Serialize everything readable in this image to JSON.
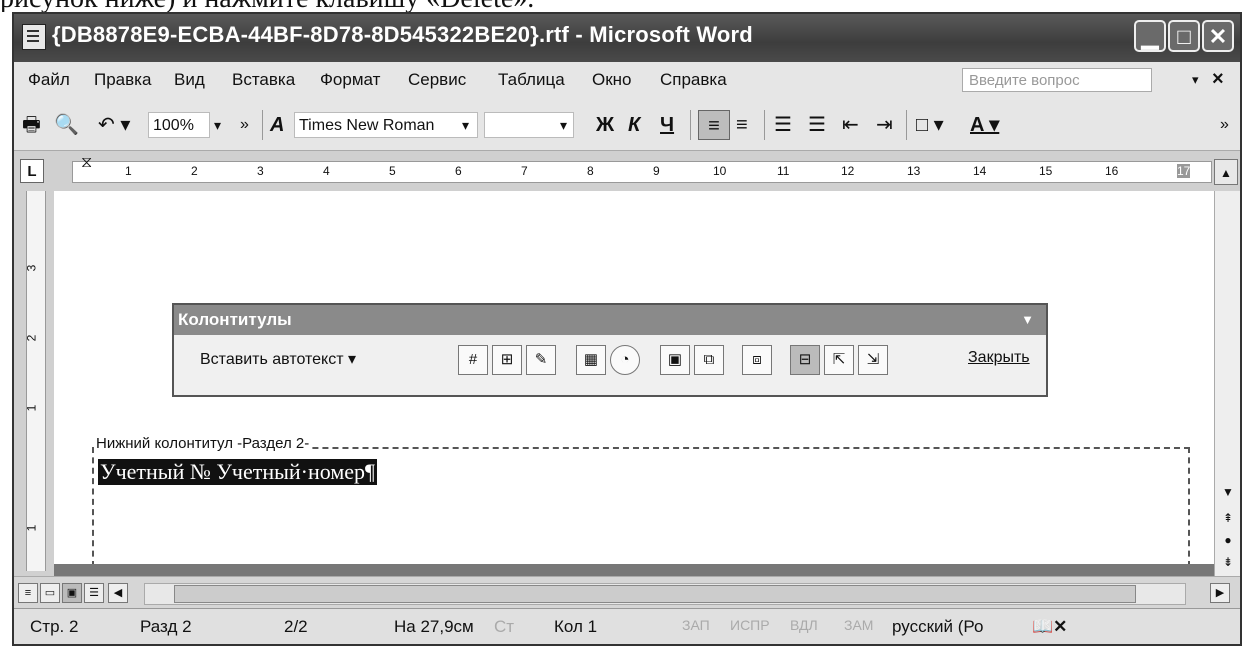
{
  "caption": "рисунок ниже) и нажмите клавишу «Delete».",
  "window": {
    "title": "{DB8878E9-ECBA-44BF-8D78-8D545322BE20}.rtf - Microsoft Word"
  },
  "menu": {
    "items": [
      "Файл",
      "Правка",
      "Вид",
      "Вставка",
      "Формат",
      "Сервис",
      "Таблица",
      "Окно",
      "Справка"
    ],
    "ask_placeholder": "Введите вопрос"
  },
  "toolbar": {
    "zoom": "100%",
    "font_name": "Times New Roman",
    "font_size": "",
    "bold": "Ж",
    "italic": "К",
    "underline": "Ч"
  },
  "ruler": {
    "tab_selector": "L",
    "numbers": [
      "1",
      "2",
      "3",
      "4",
      "5",
      "6",
      "7",
      "8",
      "9",
      "10",
      "11",
      "12",
      "13",
      "14",
      "15",
      "16",
      "17"
    ]
  },
  "vruler": {
    "numbers": [
      "3",
      "2",
      "1",
      "1"
    ]
  },
  "hf_toolbar": {
    "title": "Колонтитулы",
    "insert_autotext": "Вставить автотекст ▾",
    "close": "Закрыть"
  },
  "footer": {
    "label": "Нижний колонтитул -Раздел 2-",
    "text": "Учетный № Учетный·номер¶"
  },
  "status": {
    "page": "Стр. 2",
    "section": "Разд 2",
    "pages": "2/2",
    "at": "На 27,9см",
    "line": "Ст",
    "col": "Кол 1",
    "rec": "ЗАП",
    "trk": "ИСПР",
    "ext": "ВДЛ",
    "ovr": "ЗАМ",
    "lang": "русский (Ро"
  },
  "colors": {
    "titlebar": "#4a4a4a",
    "selection": "#111111"
  }
}
